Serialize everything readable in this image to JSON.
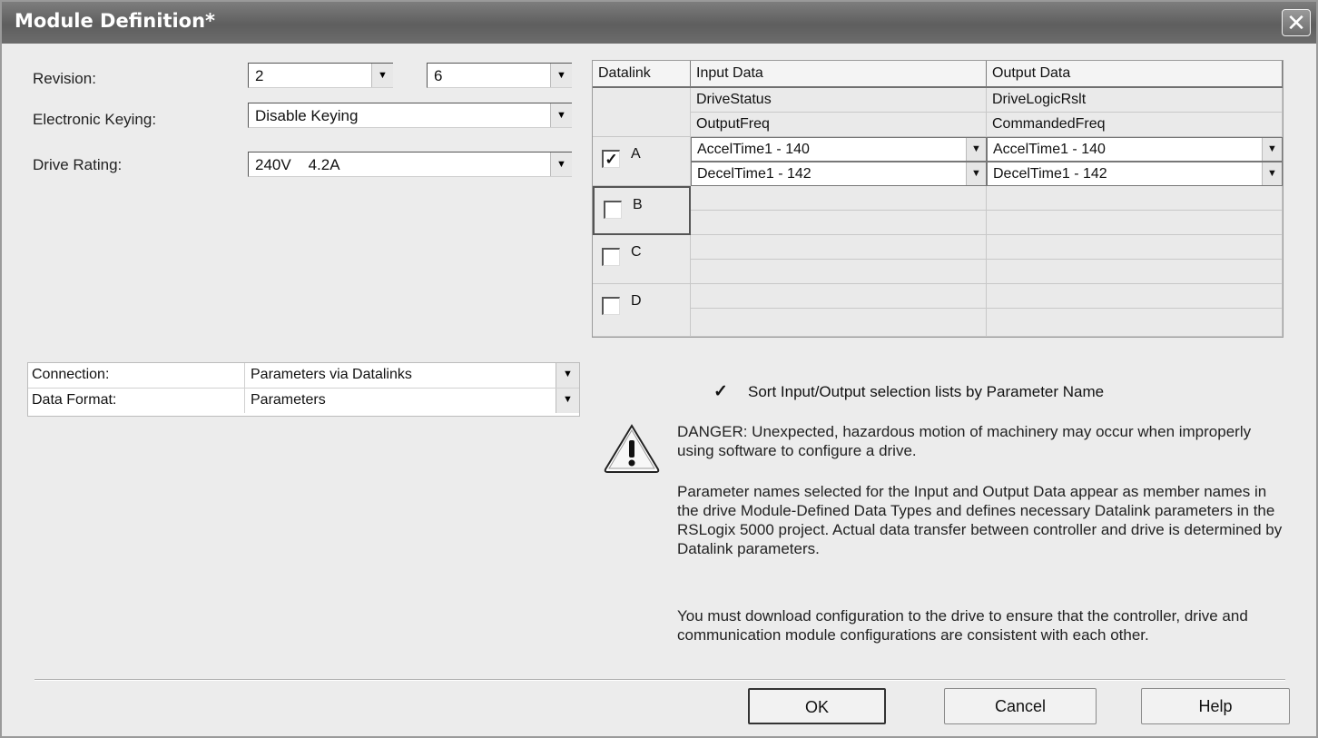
{
  "window": {
    "title": "Module Definition*",
    "close_glyph": "✕"
  },
  "form": {
    "revision_label": "Revision:",
    "revision_major": "2",
    "revision_minor": "6",
    "keying_label": "Electronic Keying:",
    "keying_value": "Disable Keying",
    "rating_label": "Drive Rating:",
    "rating_value": "240V    4.2A"
  },
  "datalink_grid": {
    "headers": [
      "Datalink",
      "Input Data",
      "Output Data"
    ],
    "fixed_rows": [
      {
        "input": "DriveStatus",
        "output": "DriveLogicRslt"
      },
      {
        "input": "OutputFreq",
        "output": "CommandedFreq"
      }
    ],
    "datalinks": [
      {
        "label": "A",
        "checked": true,
        "rows": [
          {
            "input": "AccelTime1 - 140",
            "output": "AccelTime1 - 140"
          },
          {
            "input": "DecelTime1 - 142",
            "output": "DecelTime1 - 142"
          }
        ]
      },
      {
        "label": "B",
        "checked": false,
        "rows": []
      },
      {
        "label": "C",
        "checked": false,
        "rows": []
      },
      {
        "label": "D",
        "checked": false,
        "rows": []
      }
    ]
  },
  "connection": {
    "connection_label": "Connection:",
    "connection_value": "Parameters via Datalinks",
    "format_label": "Data Format:",
    "format_value": "Parameters"
  },
  "sort_option": {
    "label": "Sort Input/Output selection lists by Parameter Name",
    "checked": true
  },
  "messages": {
    "danger": "DANGER: Unexpected, hazardous motion of machinery may occur when improperly using software to configure a drive.",
    "info1": "Parameter names selected for the Input and Output Data appear as member names in the drive Module-Defined Data Types and defines necessary Datalink parameters in the RSLogix 5000 project. Actual data transfer between controller and drive is determined by Datalink parameters.",
    "info2": "You must download configuration to the drive to ensure that the controller, drive and communication module configurations are consistent with each other."
  },
  "buttons": {
    "ok": "OK",
    "cancel": "Cancel",
    "help": "Help"
  },
  "icons": {
    "dropdown": "chevron-down-icon",
    "warning": "warning-triangle-icon",
    "check": "checkmark-icon"
  },
  "colors": {
    "titlebar": "#6a6a6a",
    "dialog_bg": "#ececec"
  }
}
